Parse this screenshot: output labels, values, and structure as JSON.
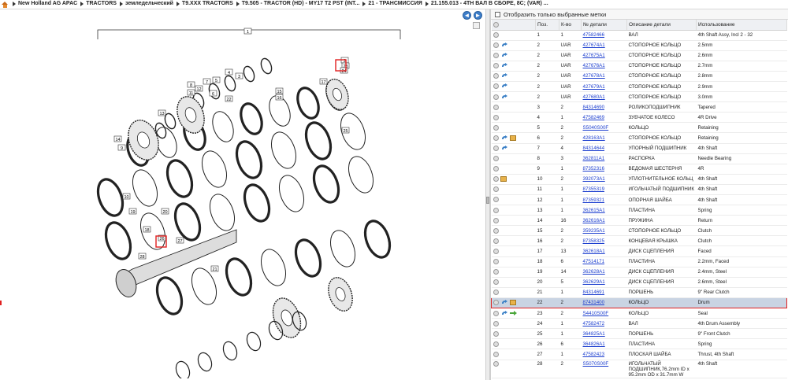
{
  "breadcrumb": [
    "New Holland AG APAC",
    "TRACTORS",
    "земледельческий",
    "T9.XXX TRACTORS",
    "T9.505 - TRACTOR (HD) - MY17 T2 PST (INT...",
    "21 - ТРАНСМИССИЯ",
    "21.155.013 - 4TH ВАЛ В СБОРЕ, 8C; (VAR) ..."
  ],
  "nav": {
    "back": "◄",
    "forward": "►"
  },
  "filter_label": "Отобразить только выбранные метки",
  "columns": [
    "Поз.",
    "К-во",
    "№ детали",
    "Описание детали",
    "Использование"
  ],
  "callouts": [
    "1",
    "2",
    "3",
    "4",
    "5",
    "6",
    "7",
    "8",
    "9",
    "10",
    "11",
    "12",
    "13",
    "14",
    "15",
    "16",
    "17",
    "18",
    "19",
    "20",
    "21",
    "22",
    "23",
    "24",
    "25",
    "26",
    "27",
    "28"
  ],
  "rows": [
    {
      "pos": "1",
      "qty": "1",
      "part": "47582466",
      "desc": "ВАЛ",
      "use": "4th Shaft Assy, Incl 2 - 32",
      "icons": []
    },
    {
      "pos": "2",
      "qty": "UAR",
      "part": "427674A1",
      "desc": "СТОПОРНОЕ КОЛЬЦО",
      "use": "2.5mm",
      "icons": [
        "arrow"
      ]
    },
    {
      "pos": "2",
      "qty": "UAR",
      "part": "427675A1",
      "desc": "СТОПОРНОЕ КОЛЬЦО",
      "use": "2.6mm",
      "icons": [
        "arrow"
      ]
    },
    {
      "pos": "2",
      "qty": "UAR",
      "part": "427676A1",
      "desc": "СТОПОРНОЕ КОЛЬЦО",
      "use": "2.7mm",
      "icons": [
        "arrow"
      ]
    },
    {
      "pos": "2",
      "qty": "UAR",
      "part": "427678A1",
      "desc": "СТОПОРНОЕ КОЛЬЦО",
      "use": "2.8mm",
      "icons": [
        "arrow"
      ]
    },
    {
      "pos": "2",
      "qty": "UAR",
      "part": "427679A1",
      "desc": "СТОПОРНОЕ КОЛЬЦО",
      "use": "2.9mm",
      "icons": [
        "arrow"
      ]
    },
    {
      "pos": "2",
      "qty": "UAR",
      "part": "427680A1",
      "desc": "СТОПОРНОЕ КОЛЬЦО",
      "use": "3.0mm",
      "icons": [
        "arrow"
      ]
    },
    {
      "pos": "3",
      "qty": "2",
      "part": "84314690",
      "desc": "РОЛИКОПОДШИПНИК",
      "use": "Tapered",
      "icons": []
    },
    {
      "pos": "4",
      "qty": "1",
      "part": "47582469",
      "desc": "ЗУБЧАТОЕ КОЛЕСО",
      "use": "4R Drive",
      "icons": []
    },
    {
      "pos": "5",
      "qty": "2",
      "part": "S5040S00F",
      "desc": "КОЛЬЦО",
      "use": "Retaining",
      "icons": []
    },
    {
      "pos": "6",
      "qty": "2",
      "part": "428163A1",
      "desc": "СТОПОРНОЕ КОЛЬЦО",
      "use": "Retaining",
      "icons": [
        "arrow",
        "box"
      ]
    },
    {
      "pos": "7",
      "qty": "4",
      "part": "84314644",
      "desc": "УПОРНЫЙ ПОДШИПНИК",
      "use": "4th Shaft",
      "icons": [
        "arrow"
      ]
    },
    {
      "pos": "8",
      "qty": "3",
      "part": "362811A1",
      "desc": "РАСПОРКА",
      "use": "Needle Bearing",
      "icons": []
    },
    {
      "pos": "9",
      "qty": "1",
      "part": "87352316",
      "desc": "ВЕДОМАЯ ШЕСТЕРНЯ",
      "use": "4R",
      "icons": []
    },
    {
      "pos": "10",
      "qty": "2",
      "part": "392073A1",
      "desc": "УПЛОТНИТЕЛЬНОЕ КОЛЬЦ",
      "use": "4th Shaft",
      "icons": [
        "box"
      ]
    },
    {
      "pos": "11",
      "qty": "1",
      "part": "87355319",
      "desc": "ИГОЛЬЧАТЫЙ ПОДШИПНИК",
      "use": "4th Shaft",
      "icons": []
    },
    {
      "pos": "12",
      "qty": "1",
      "part": "87359321",
      "desc": "ОПОРНАЯ ШАЙБА",
      "use": "4th Shaft",
      "icons": []
    },
    {
      "pos": "13",
      "qty": "1",
      "part": "362615A1",
      "desc": "ПЛАСТИНА",
      "use": "Spring",
      "icons": []
    },
    {
      "pos": "14",
      "qty": "16",
      "part": "362616A1",
      "desc": "ПРУЖИНА",
      "use": "Return",
      "icons": []
    },
    {
      "pos": "15",
      "qty": "2",
      "part": "359235A1",
      "desc": "СТОПОРНОЕ КОЛЬЦО",
      "use": "Clutch",
      "icons": []
    },
    {
      "pos": "16",
      "qty": "2",
      "part": "87358325",
      "desc": "КОНЦЕВАЯ КРЫШКА",
      "use": "Clutch",
      "icons": []
    },
    {
      "pos": "17",
      "qty": "13",
      "part": "362618A1",
      "desc": "ДИСК СЦЕПЛЕНИЯ",
      "use": "Faced",
      "icons": []
    },
    {
      "pos": "18",
      "qty": "6",
      "part": "47514171",
      "desc": "ПЛАСТИНА",
      "use": "2.2mm, Faced",
      "icons": []
    },
    {
      "pos": "19",
      "qty": "14",
      "part": "362628A1",
      "desc": "ДИСК СЦЕПЛЕНИЯ",
      "use": "2.4mm, Steel",
      "icons": []
    },
    {
      "pos": "20",
      "qty": "5",
      "part": "362629A1",
      "desc": "ДИСК СЦЕПЛЕНИЯ",
      "use": "2.6mm, Steel",
      "icons": []
    },
    {
      "pos": "21",
      "qty": "1",
      "part": "84314691",
      "desc": "ПОРШЕНЬ",
      "use": "9\" Rear Clutch",
      "icons": []
    },
    {
      "pos": "22",
      "qty": "2",
      "part": "87431400",
      "desc": "КОЛЬЦО",
      "use": "Drum",
      "icons": [
        "arrow",
        "box"
      ],
      "selected": true
    },
    {
      "pos": "23",
      "qty": "2",
      "part": "S4410S00F",
      "desc": "КОЛЬЦО",
      "use": "Seal",
      "icons": [
        "arrow",
        "green"
      ]
    },
    {
      "pos": "24",
      "qty": "1",
      "part": "47582472",
      "desc": "ВАЛ",
      "use": "4th Drum Assembly",
      "icons": []
    },
    {
      "pos": "25",
      "qty": "1",
      "part": "364825A1",
      "desc": "ПОРШЕНЬ",
      "use": "9\" Front Clutch",
      "icons": []
    },
    {
      "pos": "26",
      "qty": "6",
      "part": "364826A1",
      "desc": "ПЛАСТИНА",
      "use": "Spring",
      "icons": []
    },
    {
      "pos": "27",
      "qty": "1",
      "part": "47582423",
      "desc": "ПЛОСКАЯ ШАЙБА",
      "use": "Thrust, 4th Shaft",
      "icons": []
    },
    {
      "pos": "28",
      "qty": "2",
      "part": "S5070S00F",
      "desc": "ИГОЛЬЧАТЫЙ ПОДШИПНИК,76.2mm ID x 95.2mm OD x 31.7mm W",
      "use": "4th Shaft",
      "icons": []
    }
  ],
  "colors": {
    "link": "#1d3fcf",
    "selection_border": "#e02020",
    "selection_bg": "#c9d4e3",
    "nav_blue": "#3d7ec9"
  }
}
